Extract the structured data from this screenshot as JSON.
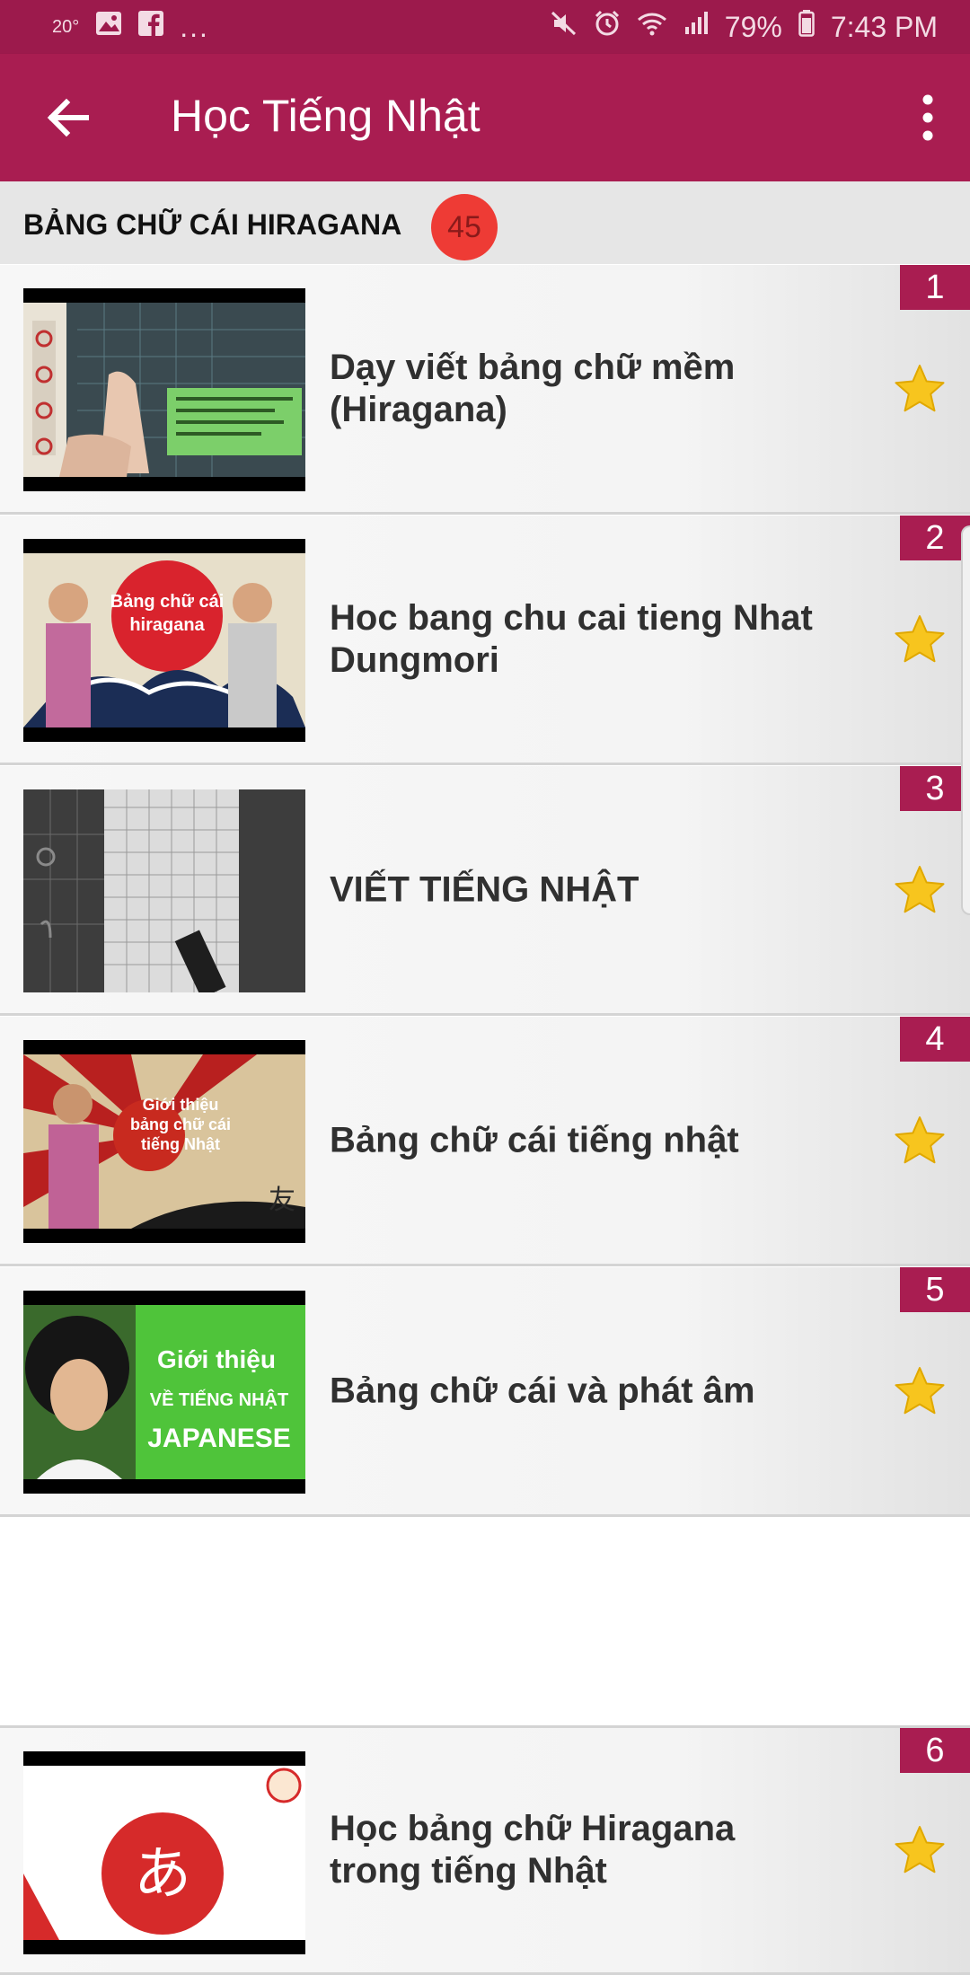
{
  "status_bar": {
    "temp": "20°",
    "dots": "...",
    "battery": "79%",
    "time": "7:43 PM"
  },
  "app_bar": {
    "title": "Học Tiếng Nhật"
  },
  "section": {
    "title": "BẢNG CHỮ CÁI HIRAGANA",
    "count": "45"
  },
  "thumb_texts": {
    "t2_line1": "Bảng chữ cái",
    "t2_line2": "hiragana",
    "t4_line1": "Giới thiệu",
    "t4_line2": "bảng chữ cái",
    "t4_line3": "tiếng Nhật",
    "t4_kanji": "友",
    "t5_line1": "Giới thiệu",
    "t5_line2": "VỀ TIẾNG NHẬT",
    "t5_line3": "JAPANESE",
    "t6_kana": "あ"
  },
  "items": [
    {
      "index": "1",
      "title": "Dạy viết bảng chữ mềm (Hiragana)"
    },
    {
      "index": "2",
      "title": "Hoc bang chu cai tieng Nhat Dungmori"
    },
    {
      "index": "3",
      "title": "VIẾT TIẾNG NHẬT"
    },
    {
      "index": "4",
      "title": "Bảng chữ cái tiếng nhật"
    },
    {
      "index": "5",
      "title": "Bảng chữ cái và phát âm"
    },
    {
      "index": "6",
      "title": "Học bảng chữ Hiragana trong tiếng Nhật"
    }
  ],
  "colors": {
    "primary": "#a91d51",
    "status_bar": "#9c1a4c",
    "badge_red": "#ee3b35",
    "star": "#f7c51e"
  }
}
